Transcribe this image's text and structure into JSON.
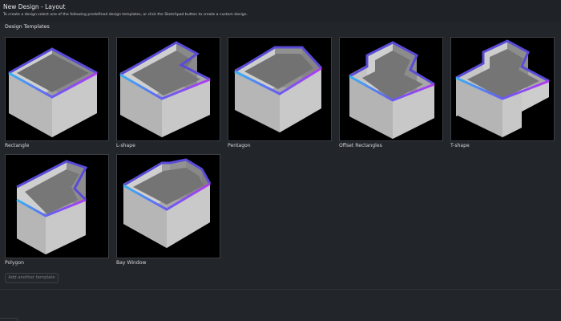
{
  "header": {
    "title": "New Design - Layout",
    "subtitle": "To create a design select one of the following predefined design templates, or click the Sketchpad button to create a custom design."
  },
  "section": {
    "label": "Design Templates"
  },
  "templates": [
    {
      "label": "Rectangle",
      "icon": "rectangle-room-icon"
    },
    {
      "label": "L-shape",
      "icon": "l-shape-room-icon"
    },
    {
      "label": "Pentagon",
      "icon": "pentagon-room-icon"
    },
    {
      "label": "Offset Rectangles",
      "icon": "offset-rectangles-room-icon"
    },
    {
      "label": "T-shape",
      "icon": "t-shape-room-icon"
    },
    {
      "label": "Polygon",
      "icon": "polygon-room-icon"
    },
    {
      "label": "Bay Window",
      "icon": "bay-window-room-icon"
    }
  ],
  "add_button": {
    "label": "Add another template"
  },
  "colors": {
    "background": "#22252a",
    "thumb_background": "#000000",
    "accent_blue": "#3aa8f0",
    "accent_purple": "#b03cf0",
    "wall_light": "#d2d2d2",
    "wall_mid": "#a9a9a9",
    "floor": "#8e8e8e"
  }
}
